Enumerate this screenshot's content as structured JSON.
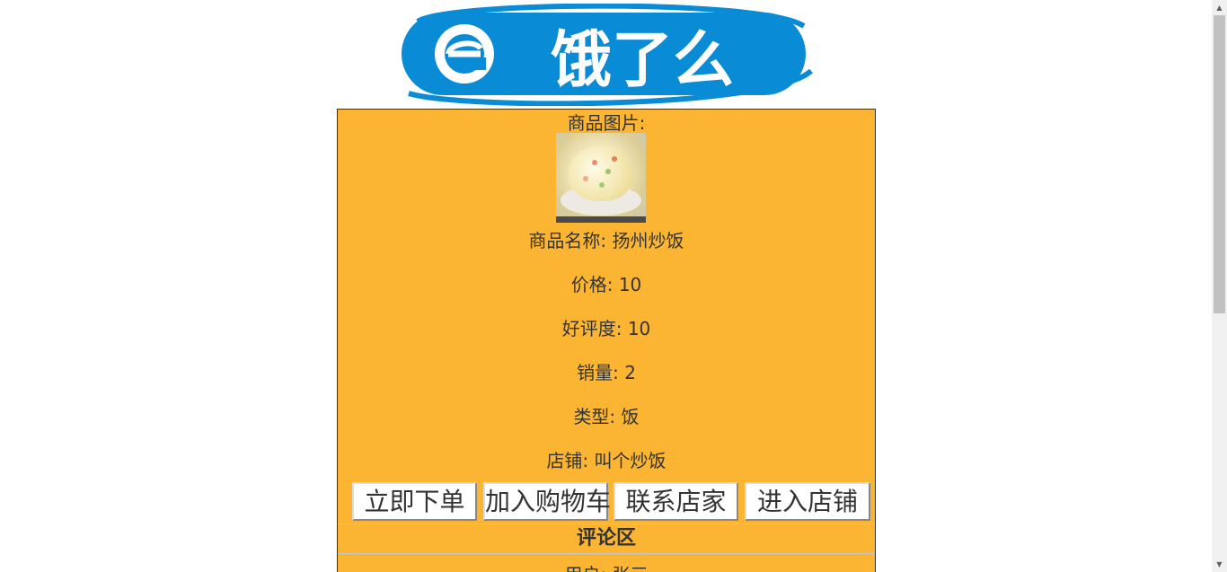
{
  "logo": {
    "text": "饿了么",
    "color": "#0a8bd6"
  },
  "product": {
    "image_label": "商品图片:",
    "name_label": "商品名称:",
    "name": "扬州炒饭",
    "price_label": "价格:",
    "price": "10",
    "rating_label": "好评度:",
    "rating": "10",
    "sales_label": "销量:",
    "sales": "2",
    "type_label": "类型:",
    "type": "饭",
    "store_label": "店铺:",
    "store": "叫个炒饭"
  },
  "buttons": {
    "order": "立即下单",
    "cart": "加入购物车",
    "contact": "联系店家",
    "store": "进入店铺"
  },
  "comments": {
    "title": "评论区",
    "user_label": "用户:",
    "user": "张三"
  },
  "colors": {
    "panel_bg": "#fbb532",
    "brand_blue": "#0a8bd6"
  }
}
